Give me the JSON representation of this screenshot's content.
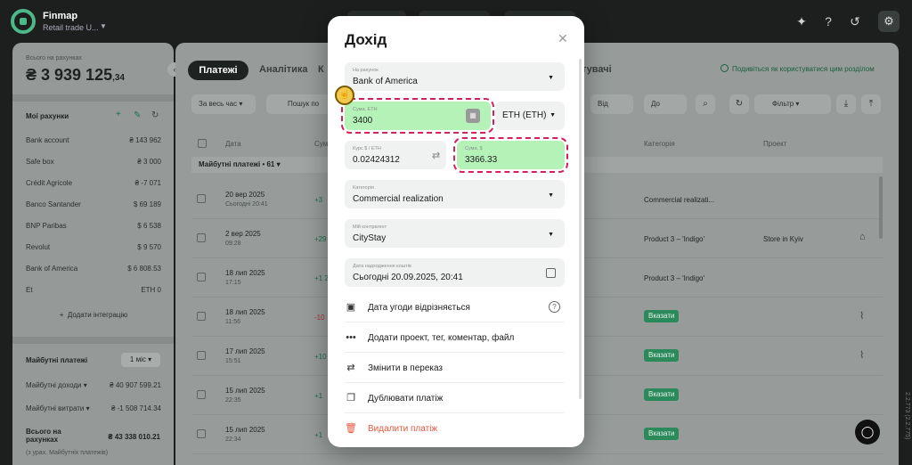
{
  "app": {
    "name": "Finmap",
    "company": "Retail trade U..."
  },
  "sidebar": {
    "total_label": "Всього на рахунках",
    "total_value": "₴ 3 939 125",
    "total_cents": ",34",
    "accounts_title": "Мої рахунки",
    "accounts": [
      {
        "name": "Bank account",
        "value": "₴ 143 962"
      },
      {
        "name": "Safe box",
        "value": "₴ 3 000"
      },
      {
        "name": "Crédit Agricole",
        "value": "₴ -7 071"
      },
      {
        "name": "Banco Santander",
        "value": "$ 69 189"
      },
      {
        "name": "BNP Paribas",
        "value": "$ 6 538"
      },
      {
        "name": "Revolut",
        "value": "$ 9 570"
      },
      {
        "name": "Bank of America",
        "value": "$ 6 808.53"
      },
      {
        "name": "Et",
        "value": "ETH 0"
      }
    ],
    "add_integration": "Додати інтеграцію",
    "future_title": "Майбутні платежі",
    "future_period": "1 міс",
    "future_income_label": "Майбутні доходи",
    "future_income_value": "₴ 40 907 599.21",
    "future_expense_label": "Майбутні витрати",
    "future_expense_value": "₴ -1 508 714.34",
    "total_accounts_label": "Всього на рахунках",
    "total_accounts_value": "₴ 43 338 010.21",
    "total_accounts_note": "(з урах. Майбутніх платежів)"
  },
  "main": {
    "tabs": [
      "Платежі",
      "Аналітика",
      "К"
    ],
    "tab_tail": "тувачі",
    "help_link": "Подивіться як користуватися цим розділом",
    "period": "За весь час",
    "search_placeholder": "Пошук по",
    "from_placeholder": "Від",
    "to_placeholder": "До",
    "filter_label": "Фільтр",
    "headers": {
      "date": "Дата",
      "sum": "Сум",
      "category": "Категорія",
      "project": "Проект"
    },
    "group_label": "Майбутні платежі • 61",
    "rows": [
      {
        "date": "20 вер 2025",
        "sub": "Сьогодні 20:41",
        "amount": "+3",
        "category": "Commercial realizati...",
        "project": "",
        "badge": ""
      },
      {
        "date": "2 вер 2025",
        "sub": "09:28",
        "amount": "+29",
        "category": "Product 3 – 'Indigo'",
        "project": "Store in Kyiv",
        "badge": ""
      },
      {
        "date": "18 лип 2025",
        "sub": "17:15",
        "amount": "+1 2",
        "category": "Product 3 – 'Indigo'",
        "project": "",
        "badge": ""
      },
      {
        "date": "18 лип 2025",
        "sub": "11:56",
        "amount": "-10",
        "category": "",
        "project": "",
        "badge": "Вказати"
      },
      {
        "date": "17 лип 2025",
        "sub": "15:51",
        "amount": "+10",
        "category": "",
        "project": "",
        "badge": "Вказати"
      },
      {
        "date": "15 лип 2025",
        "sub": "22:35",
        "amount": "+1",
        "category": "",
        "project": "",
        "badge": "Вказати"
      },
      {
        "date": "15 лип 2025",
        "sub": "22:34",
        "amount": "+1",
        "category": "",
        "project": "",
        "badge": "Вказати"
      }
    ]
  },
  "modal": {
    "title": "Дохід",
    "account_label": "На рахунок",
    "account_value": "Bank of America",
    "amount_label": "Сума, ETH",
    "amount_value": "3400",
    "currency": "ETH (ETH)",
    "rate_label": "Курс $ / ETH",
    "rate_value": "0.02424312",
    "sum_usd_label": "Сума, $",
    "sum_usd_value": "3366.33",
    "category_label": "Категорія",
    "category_value": "Commercial realization",
    "counterparty_label": "Мій контрагент",
    "counterparty_value": "CityStay",
    "date_label": "Дата надходження коштів",
    "date_value": "Сьогодні 20.09.2025, 20:41",
    "actions": {
      "deal_date": "Дата угоди відрізняється",
      "add_more": "Додати проект, тег, коментар, файл",
      "to_transfer": "Змінити в переказ",
      "duplicate": "Дублювати платіж",
      "delete": "Видалити платіж"
    }
  },
  "version": "2.2.773 (2.2.775)",
  "colors": {
    "accent_green": "#4db88a",
    "highlight_green": "#b4f2b8",
    "dashed_border": "#d41f5b",
    "danger": "#e4573d"
  }
}
